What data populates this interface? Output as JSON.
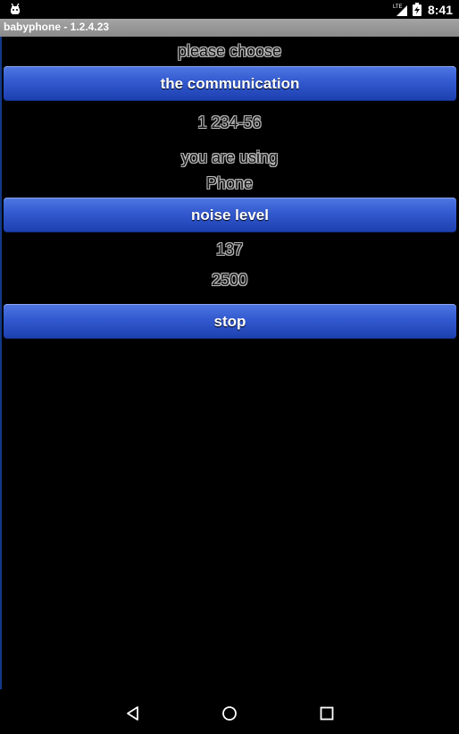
{
  "status_bar": {
    "time": "8:41",
    "network": "LTE",
    "icons": [
      "android-icon",
      "lte-signal-icon",
      "battery-charging-icon"
    ]
  },
  "app": {
    "title": "babyphone - 1.2.4.23"
  },
  "main": {
    "prompt_label": "please choose",
    "communication_button": "the communication",
    "number_label": "1 234-56",
    "using_label": "you are using",
    "device_label": "Phone",
    "noise_button": "noise level",
    "noise_value": "137",
    "threshold_value": "2500",
    "stop_button": "stop"
  },
  "colors": {
    "button_top": "#4f77e2",
    "button_bottom": "#1d3fae",
    "title_bar": "#9a9a9a",
    "background": "#000000"
  },
  "nav_bar": {
    "icons": [
      "back-icon",
      "home-icon",
      "recents-icon"
    ]
  }
}
